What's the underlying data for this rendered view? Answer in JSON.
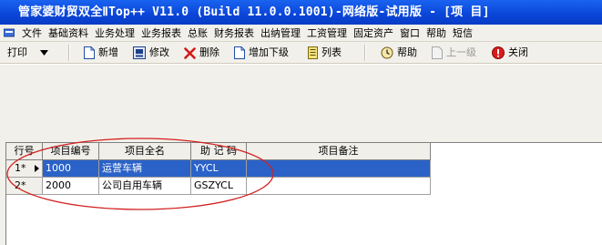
{
  "window": {
    "title": "管家婆财贸双全ⅡTop++ V11.0 (Build 11.0.0.1001)-网络版-试用版 - [项    目]"
  },
  "menu": {
    "items": [
      "文件",
      "基础资料",
      "业务处理",
      "业务报表",
      "总账",
      "财务报表",
      "出纳管理",
      "工资管理",
      "固定资产",
      "窗口",
      "帮助",
      "短信"
    ]
  },
  "toolbar": {
    "print_label": "打印",
    "new_label": "新增",
    "edit_label": "修改",
    "delete_label": "删除",
    "add_sub_label": "增加下级",
    "list_label": "列表",
    "help_label": "帮助",
    "up_level_label": "上一级",
    "close_label": "关闭"
  },
  "grid": {
    "columns": [
      "行号",
      "项目编号",
      "项目全名",
      "助 记 码",
      "项目备注"
    ],
    "rows": [
      {
        "no": "1*",
        "code": "1000",
        "name": "运营车辆",
        "mnemonic": "YYCL",
        "note": ""
      },
      {
        "no": "2*",
        "code": "2000",
        "name": "公司自用车辆",
        "mnemonic": "GSZYCL",
        "note": ""
      }
    ],
    "selected_row": 1
  },
  "colors": {
    "titlebar": "#0a45d8",
    "selection": "#2a62c8",
    "annotation": "#d21f1f",
    "chrome": "#f2f0ea"
  }
}
